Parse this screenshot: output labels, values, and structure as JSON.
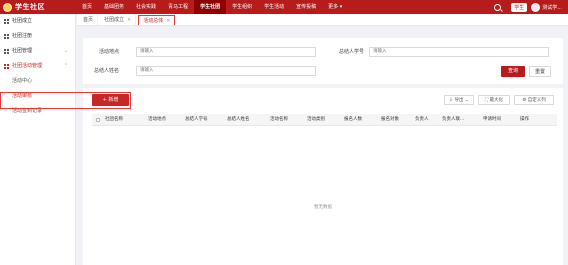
{
  "brand": {
    "logo_text": "学生社区"
  },
  "top_nav": {
    "items": [
      {
        "label": "首页",
        "active": false
      },
      {
        "label": "基础团务",
        "active": false
      },
      {
        "label": "社会实践",
        "active": false
      },
      {
        "label": "青马工程",
        "active": false
      },
      {
        "label": "学生社团",
        "active": true
      },
      {
        "label": "学生组织",
        "active": false
      },
      {
        "label": "学生活动",
        "active": false
      },
      {
        "label": "宣传投稿",
        "active": false
      },
      {
        "label": "更多 ▾",
        "active": false
      }
    ],
    "role_badge": "学生",
    "username": "测试学..."
  },
  "sidebar": {
    "items": [
      {
        "label": "社团成立",
        "chevron": ""
      },
      {
        "label": "社团注册",
        "chevron": ""
      },
      {
        "label": "社团管理",
        "chevron": "⌄"
      },
      {
        "label": "社团活动管理",
        "chevron": "⌃"
      }
    ],
    "sub_items": [
      {
        "label": "活动中心"
      },
      {
        "label": "活动审核"
      },
      {
        "label": "活动签到记录"
      }
    ]
  },
  "tabs": [
    {
      "label": "首页",
      "close": ""
    },
    {
      "label": "社团成立",
      "close": "×"
    },
    {
      "label": "活动总体",
      "close": "×"
    }
  ],
  "filter": {
    "location_label": "活动地点",
    "location_placeholder": "请输入",
    "leader_id_label": "总结人学号",
    "leader_id_placeholder": "请输入",
    "leader_name_label": "总结人姓名",
    "leader_name_placeholder": "请输入",
    "query_label": "查询",
    "reset_label": "重置"
  },
  "toolbar": {
    "add_label": "+ 新增",
    "export_label": "⇩ 导出 ⌄",
    "maximize_label": "⛶ 最大化",
    "columns_label": "⚙ 自定义列"
  },
  "table": {
    "columns": [
      "社团名称",
      "活动地点",
      "总结人学号",
      "总结人姓名",
      "活动名称",
      "活动类别",
      "报名人数",
      "报名对象",
      "负责人",
      "负责人联...",
      "申请时间",
      "操作"
    ],
    "empty_text": "暂无数据"
  }
}
